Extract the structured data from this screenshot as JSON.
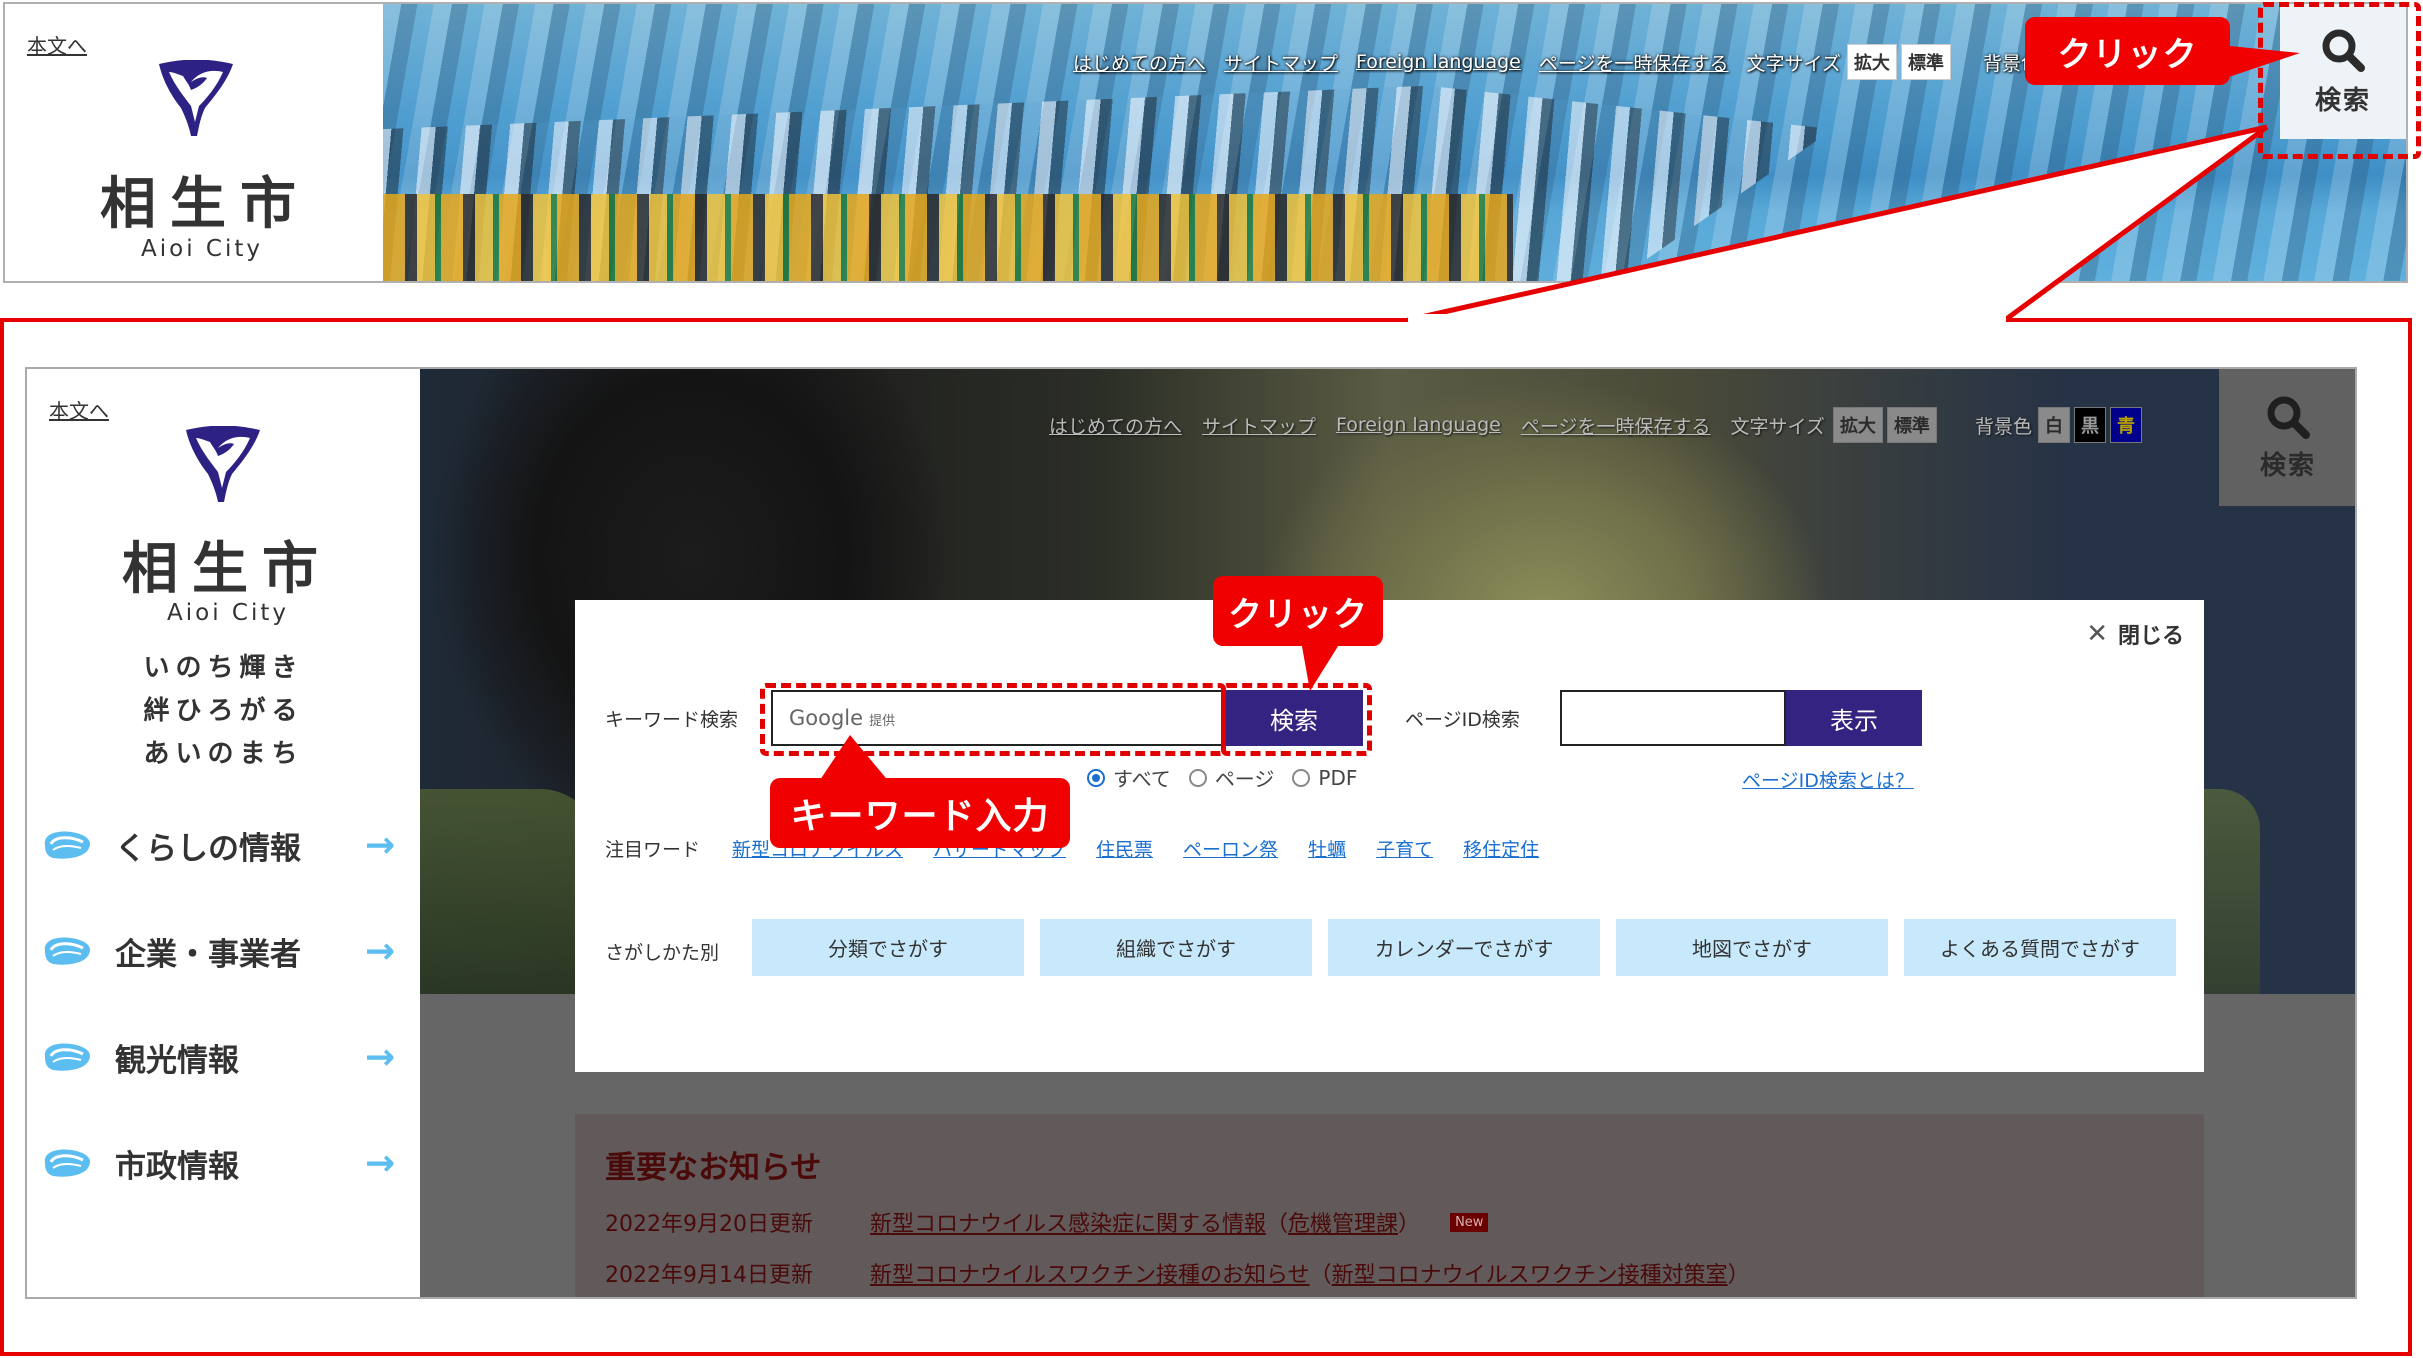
{
  "site": {
    "skip_link": "本文へ",
    "city_name": "相生市",
    "city_name_en": "Aioi City",
    "tagline": [
      "いのち輝き",
      "絆ひろがる",
      "あいのまち"
    ]
  },
  "utility_nav": {
    "links": [
      "はじめての方へ",
      "サイトマップ",
      "Foreign language",
      "ページを一時保存する"
    ],
    "font_size_label": "文字サイズ",
    "font_size_buttons": [
      "拡大",
      "標準"
    ],
    "bg_color_label": "背景色",
    "bg_color_buttons": [
      {
        "label": "白",
        "bg": "#8a8a8a",
        "fg": "#2b2b2b"
      },
      {
        "label": "黒",
        "bg": "#000000",
        "fg": "#9a9a9a"
      },
      {
        "label": "青",
        "bg": "#00008b",
        "fg": "#b8a200"
      }
    ],
    "search_button_label": "検索"
  },
  "annotations": {
    "click_label_1": "クリック",
    "click_label_2": "クリック",
    "keyword_input_label": "キーワード入力",
    "accent_red": "#f00000"
  },
  "sidebar": {
    "items": [
      {
        "label": "くらしの情報"
      },
      {
        "label": "企業・事業者"
      },
      {
        "label": "観光情報"
      },
      {
        "label": "市政情報"
      }
    ],
    "arrow_color": "#5bbdf0"
  },
  "search_modal": {
    "close_label": "閉じる",
    "keyword": {
      "label": "キーワード検索",
      "placeholder_brand": "Google",
      "placeholder_suffix": "提供",
      "value": "",
      "submit_label": "検索",
      "scope_options": [
        {
          "label": "すべて",
          "selected": true
        },
        {
          "label": "ページ",
          "selected": false
        },
        {
          "label": "PDF",
          "selected": false
        }
      ]
    },
    "page_id": {
      "label": "ページID検索",
      "value": "",
      "submit_label": "表示",
      "help_link": "ページID検索とは？"
    },
    "featured_words": {
      "label": "注目ワード",
      "words": [
        "新型コロナウイルス",
        "ハザードマップ",
        "住民票",
        "ペーロン祭",
        "牡蠣",
        "子育て",
        "移住定住"
      ]
    },
    "search_by": {
      "label": "さがしかた別",
      "buttons": [
        "分類でさがす",
        "組織でさがす",
        "カレンダーでさがす",
        "地図でさがす",
        "よくある質問でさがす"
      ]
    },
    "button_color": "#352381",
    "category_color": "#c7e9fb"
  },
  "notices": {
    "title": "重要なお知らせ",
    "items": [
      {
        "date": "2022年9月20日更新",
        "title": "新型コロナウイルス感染症に関する情報",
        "dept": "危機管理課",
        "is_new": true,
        "badge": "New"
      },
      {
        "date": "2022年9月14日更新",
        "title": "新型コロナウイルスワクチン接種のお知らせ",
        "dept": "新型コロナウイルスワクチン接種対策室",
        "is_new": false,
        "badge": ""
      }
    ]
  }
}
